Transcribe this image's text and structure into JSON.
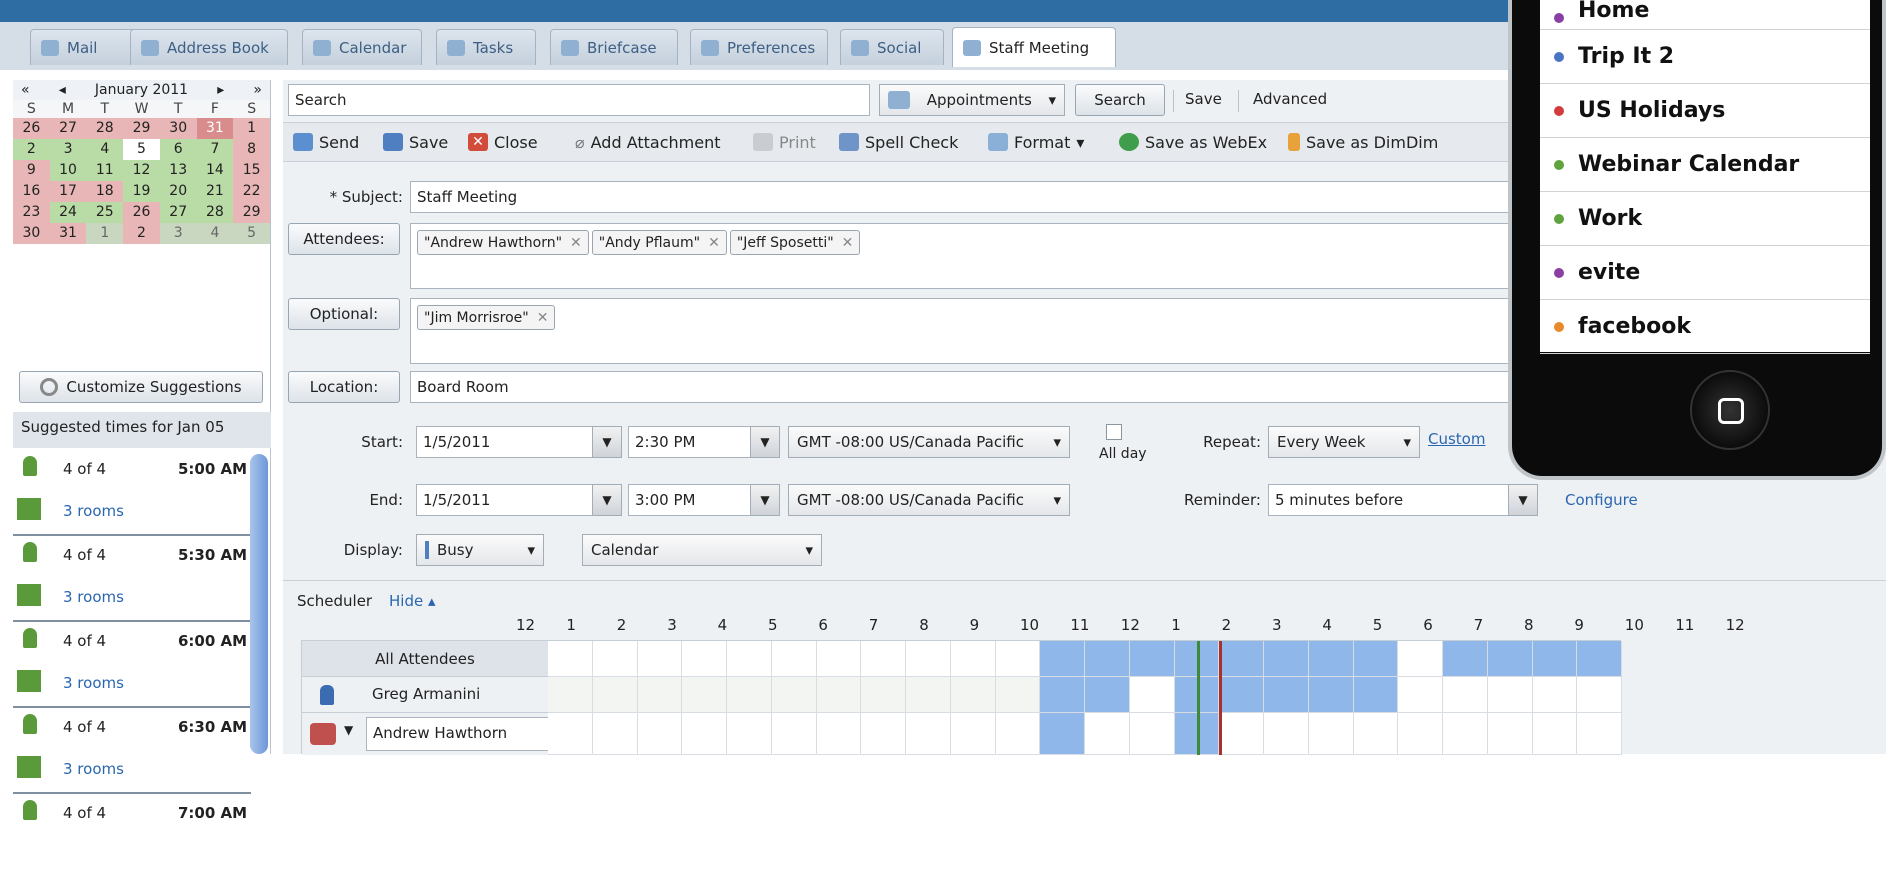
{
  "tabs": [
    {
      "label": "Mail"
    },
    {
      "label": "Address Book"
    },
    {
      "label": "Calendar"
    },
    {
      "label": "Tasks"
    },
    {
      "label": "Briefcase"
    },
    {
      "label": "Preferences"
    },
    {
      "label": "Social"
    },
    {
      "label": "Staff Meeting",
      "active": true
    }
  ],
  "minical": {
    "nav_prev_year": "«",
    "nav_prev_month": "◂",
    "month_label": "January 2011",
    "nav_next_month": "▸",
    "nav_next_year": "»",
    "days_of_week": [
      "S",
      "M",
      "T",
      "W",
      "T",
      "F",
      "S"
    ],
    "weeks": [
      [
        "26",
        "27",
        "28",
        "29",
        "30",
        "31",
        "1"
      ],
      [
        "2",
        "3",
        "4",
        "5",
        "6",
        "7",
        "8"
      ],
      [
        "9",
        "10",
        "11",
        "12",
        "13",
        "14",
        "15"
      ],
      [
        "16",
        "17",
        "18",
        "19",
        "20",
        "21",
        "22"
      ],
      [
        "23",
        "24",
        "25",
        "26",
        "27",
        "28",
        "29"
      ],
      [
        "30",
        "31",
        "1",
        "2",
        "3",
        "4",
        "5"
      ]
    ]
  },
  "suggest": {
    "customize_label": "Customize Suggestions",
    "heading": "Suggested times for Jan 05",
    "items": [
      {
        "count": "4 of 4",
        "time": "5:00 AM",
        "rooms": "3 rooms"
      },
      {
        "count": "4 of 4",
        "time": "5:30 AM",
        "rooms": "3 rooms"
      },
      {
        "count": "4 of 4",
        "time": "6:00 AM",
        "rooms": "3 rooms"
      },
      {
        "count": "4 of 4",
        "time": "6:30 AM",
        "rooms": "3 rooms"
      },
      {
        "count": "4 of 4",
        "time": "7:00 AM",
        "rooms": ""
      }
    ]
  },
  "search": {
    "placeholder": "Search",
    "type_label": "Appointments",
    "search_label": "Search",
    "save_label": "Save",
    "advanced_label": "Advanced"
  },
  "toolbar": {
    "send": "Send",
    "save": "Save",
    "close": "Close",
    "attach": "Add Attachment",
    "print": "Print",
    "spell": "Spell Check",
    "format": "Format",
    "webex": "Save as WebEx",
    "dimdim": "Save as DimDim"
  },
  "form": {
    "subject_label": "* Subject:",
    "subject_value": "Staff Meeting",
    "attendees_label": "Attendees:",
    "attendees": [
      "\"Andrew Hawthorn\"",
      "\"Andy Pflaum\"",
      "\"Jeff Sposetti\""
    ],
    "optional_label": "Optional:",
    "optional": [
      "\"Jim Morrisroe\""
    ],
    "location_label": "Location:",
    "location_value": "Board Room",
    "start_label": "Start:",
    "start_date": "1/5/2011",
    "start_time": "2:30 PM",
    "timezone": "GMT -08:00 US/Canada Pacific",
    "allday_label": "All day",
    "repeat_label": "Repeat:",
    "repeat_value": "Every Week",
    "custom_link": "Custom",
    "end_label": "End:",
    "end_date": "1/5/2011",
    "end_time": "3:00 PM",
    "reminder_label": "Reminder:",
    "reminder_value": "5 minutes before",
    "configure_link": "Configure",
    "display_label": "Display:",
    "display_value": "Busy",
    "calendar_value": "Calendar"
  },
  "scheduler": {
    "title": "Scheduler",
    "hide_link": "Hide ▴",
    "hours": [
      "12",
      "1",
      "2",
      "3",
      "4",
      "5",
      "6",
      "7",
      "8",
      "9",
      "10",
      "11",
      "12",
      "1",
      "2",
      "3",
      "4",
      "5",
      "6",
      "7",
      "8",
      "9",
      "10",
      "11",
      "12"
    ],
    "all_attendees_label": "All Attendees",
    "rows": [
      {
        "name": "Greg Armanini"
      },
      {
        "name": "Andrew Hawthorn"
      }
    ]
  },
  "phone": {
    "calendars": [
      {
        "name": "Home",
        "color": "#8a3fa3"
      },
      {
        "name": "Trip It 2",
        "color": "#4a74c4"
      },
      {
        "name": "US Holidays",
        "color": "#d23c3c"
      },
      {
        "name": "Webinar Calendar",
        "color": "#5fa33c"
      },
      {
        "name": "Work",
        "color": "#5fa33c"
      },
      {
        "name": "evite",
        "color": "#8a3fa3"
      },
      {
        "name": "facebook",
        "color": "#e8892c"
      }
    ]
  }
}
